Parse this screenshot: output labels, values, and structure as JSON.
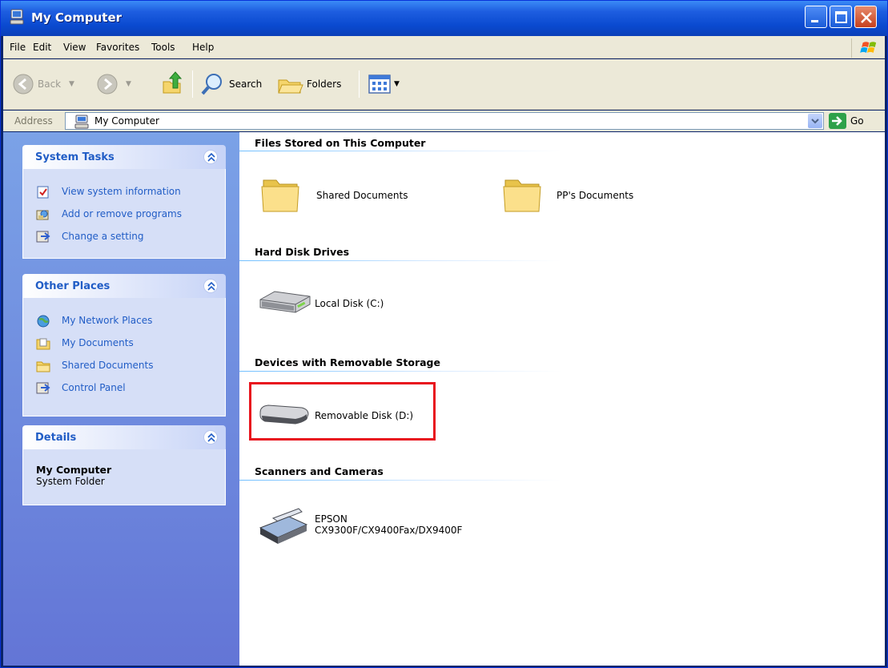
{
  "window": {
    "title": "My Computer"
  },
  "menu": {
    "items": [
      "File",
      "Edit",
      "View",
      "Favorites",
      "Tools",
      "Help"
    ]
  },
  "toolbar": {
    "back_label": "Back",
    "search_label": "Search",
    "folders_label": "Folders"
  },
  "address": {
    "label": "Address",
    "value": "My Computer",
    "go_label": "Go"
  },
  "sidebar": {
    "system_tasks": {
      "title": "System Tasks",
      "items": [
        {
          "label": "View system information",
          "icon": "system-info-icon"
        },
        {
          "label": "Add or remove programs",
          "icon": "add-remove-programs-icon"
        },
        {
          "label": "Change a setting",
          "icon": "control-panel-icon"
        }
      ]
    },
    "other_places": {
      "title": "Other Places",
      "items": [
        {
          "label": "My Network Places",
          "icon": "network-places-icon"
        },
        {
          "label": "My Documents",
          "icon": "my-documents-icon"
        },
        {
          "label": "Shared Documents",
          "icon": "shared-folder-icon"
        },
        {
          "label": "Control Panel",
          "icon": "control-panel-icon"
        }
      ]
    },
    "details": {
      "title": "Details",
      "name": "My Computer",
      "type": "System Folder"
    }
  },
  "content": {
    "groups": [
      {
        "title": "Files Stored on This Computer",
        "items": [
          {
            "label": "Shared Documents",
            "icon": "folder-icon"
          },
          {
            "label": "PP's Documents",
            "icon": "folder-icon"
          }
        ]
      },
      {
        "title": "Hard Disk Drives",
        "items": [
          {
            "label": "Local Disk (C:)",
            "icon": "hard-disk-icon"
          }
        ]
      },
      {
        "title": "Devices with Removable Storage",
        "items": [
          {
            "label": "Removable Disk (D:)",
            "icon": "removable-disk-icon"
          }
        ]
      },
      {
        "title": "Scanners and Cameras",
        "items": [
          {
            "label_line1": "EPSON",
            "label_line2": "CX9300F/CX9400Fax/DX9400F",
            "icon": "scanner-icon"
          }
        ]
      }
    ]
  },
  "colors": {
    "titlebar": "#0a4ad0",
    "taskpane": "#6f8fe0",
    "link": "#215dc6",
    "highlight": "#e8141e"
  }
}
